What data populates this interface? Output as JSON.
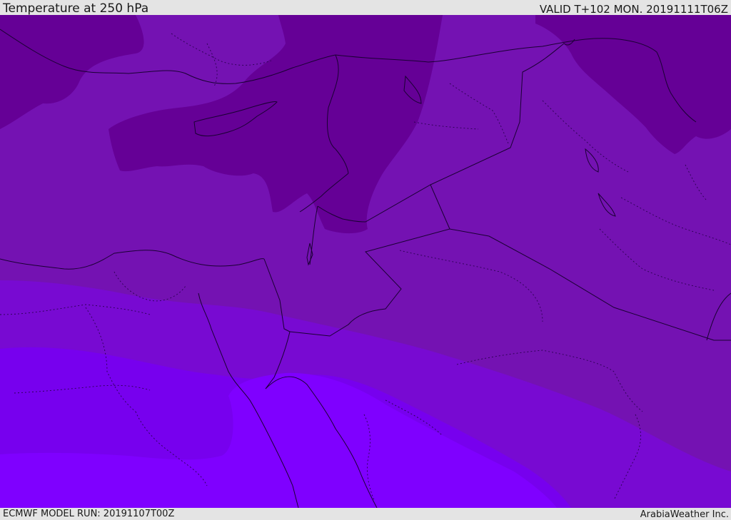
{
  "header": {
    "title": "Temperature at 250 hPa",
    "valid": "VALID T+102 MON. 20191111T06Z"
  },
  "footer": {
    "model_run": "ECMWF MODEL RUN: 20191107T00Z",
    "credit": "ArabiaWeather Inc."
  },
  "map": {
    "colors": {
      "coldest": "#650096",
      "cold": "#7412b2",
      "mild": "#780ad2",
      "warm": "#7700ee",
      "warmest": "#7f00ff",
      "borders": "#1a0033"
    }
  }
}
